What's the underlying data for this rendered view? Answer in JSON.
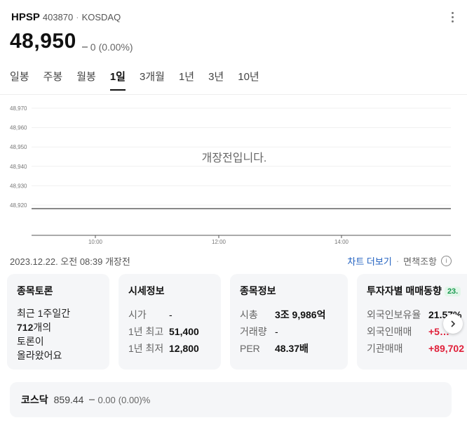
{
  "header": {
    "ticker": "HPSP",
    "code": "403870",
    "separator": "·",
    "market": "KOSDAQ"
  },
  "price": {
    "current": "48,950",
    "change": "0",
    "change_pct": "(0.00%)"
  },
  "tabs": [
    {
      "label": "일봉",
      "active": false
    },
    {
      "label": "주봉",
      "active": false
    },
    {
      "label": "월봉",
      "active": false
    },
    {
      "label": "1일",
      "active": true
    },
    {
      "label": "3개월",
      "active": false
    },
    {
      "label": "1년",
      "active": false
    },
    {
      "label": "3년",
      "active": false
    },
    {
      "label": "10년",
      "active": false
    }
  ],
  "chart_data": {
    "type": "line",
    "message": "개장전입니다.",
    "y_ticks": [
      "48,970",
      "48,960",
      "48,950",
      "48,940",
      "48,930",
      "48,920"
    ],
    "ylim": [
      48920,
      48970
    ],
    "x_ticks": [
      "10:00",
      "12:00",
      "14:00"
    ],
    "grid": true,
    "series": []
  },
  "caption": {
    "date": "2023.12.22. 오전 08:39 개장전",
    "chart_more": "차트 더보기",
    "separator": "·",
    "disclaimer": "면책조항",
    "info_icon": "i"
  },
  "cards": {
    "discussion": {
      "title": "종목토론",
      "line1": "최근 1주일간",
      "count": "712",
      "line2_suffix": "개의",
      "line3": "토론이",
      "line4": "올라왔어요"
    },
    "quote": {
      "title": "시세정보",
      "rows": [
        {
          "k": "시가",
          "v": "-"
        },
        {
          "k": "1년 최고",
          "v": "51,400"
        },
        {
          "k": "1년 최저",
          "v": "12,800"
        }
      ]
    },
    "stock": {
      "title": "종목정보",
      "rows": [
        {
          "k": "시총",
          "v": "3조 9,986억"
        },
        {
          "k": "거래량",
          "v": "-"
        },
        {
          "k": "PER",
          "v": "48.37배"
        }
      ]
    },
    "investor": {
      "title": "투자자별 매매동향",
      "badge": "23.",
      "rows": [
        {
          "k": "외국인보유율",
          "v": "21.57%"
        },
        {
          "k": "외국인매매",
          "v": "+5…"
        },
        {
          "k": "기관매매",
          "v": "+89,702"
        }
      ]
    }
  },
  "index": {
    "name": "코스닥",
    "value": "859.44",
    "change": "0.00",
    "change_pct": "(0.00)%"
  }
}
